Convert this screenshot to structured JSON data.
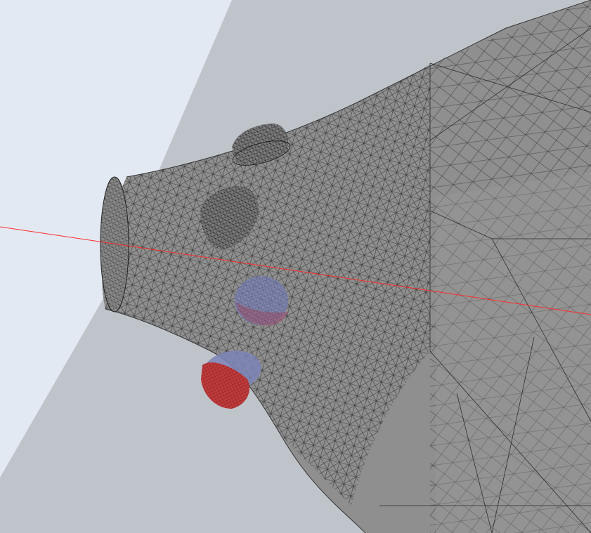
{
  "scene": {
    "background_color": "#e2e9f3",
    "ground_plane_color": "#bfc4ca",
    "mesh_fill_color": "#8f8f8f",
    "mesh_edge_color": "#2e2e2e",
    "axis_color": "#ff2a2a",
    "electrode_red_color": "#c03a3a",
    "electrode_blue_color": "#7d85b8",
    "electrodes": [
      {
        "name": "cylinder-top",
        "kind": "gray"
      },
      {
        "name": "cylinder-middle",
        "kind": "gray"
      },
      {
        "name": "sphere-blue",
        "kind": "blue"
      },
      {
        "name": "cap-red-blue",
        "kind": "red-blue"
      }
    ]
  }
}
